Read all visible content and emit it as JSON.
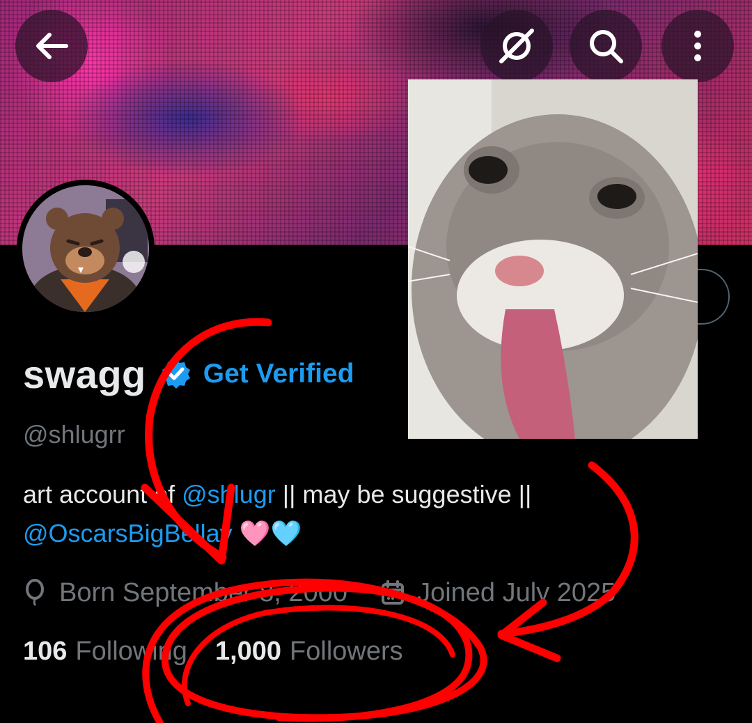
{
  "profile": {
    "name": "swagg",
    "get_verified": "Get Verified",
    "handle": "@shlugrr",
    "bio": {
      "part1": "art account of ",
      "mention1": "@shlugr",
      "part2": " || may be suggestive ||",
      "mention2": "@OscarsBigBellay",
      "emoji": "🩷🩵"
    },
    "born": "Born September 8, 2000",
    "joined": "Joined July 2025",
    "following_count": "106",
    "following_label": "Following",
    "followers_count": "1,000",
    "followers_label": "Followers"
  },
  "icons": {
    "back": "back-arrow-icon",
    "grok": "grok-icon",
    "search": "search-icon",
    "more": "more-icon",
    "verified": "verified-badge-icon",
    "birthday": "balloon-icon",
    "calendar": "calendar-icon"
  },
  "colors": {
    "background": "#000000",
    "text": "#e7e9ea",
    "secondary": "#71767b",
    "accent": "#1d9bf0",
    "annotation": "#ff0000"
  }
}
